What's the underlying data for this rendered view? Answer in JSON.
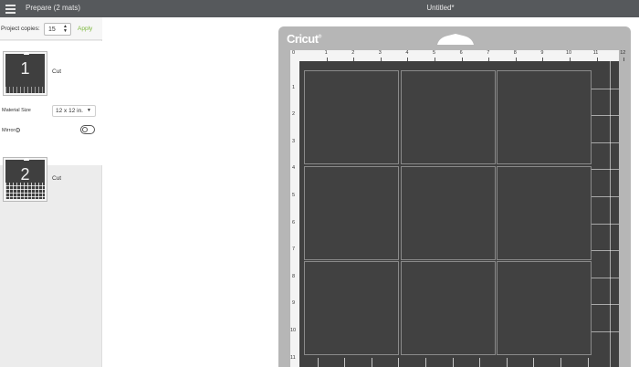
{
  "topbar": {
    "app_title": "Prepare (2 mats)",
    "document_title": "Untitled*"
  },
  "left_panel": {
    "copies_label": "Project copies:",
    "copies_value": "15",
    "apply_label": "Apply",
    "mats": [
      {
        "number": "1",
        "label": "Cut",
        "selected": true
      },
      {
        "number": "2",
        "label": "Cut",
        "selected": false
      }
    ],
    "material_size_label": "Material Size",
    "material_size_value": "12 x 12 in.",
    "mirror_label": "Mirror",
    "mirror_on": false
  },
  "canvas": {
    "brand": "Cricut",
    "ruler_top_labels": [
      "0",
      "1",
      "2",
      "3",
      "4",
      "5",
      "6",
      "7",
      "8",
      "9",
      "10",
      "11",
      "12"
    ],
    "ruler_left_labels": [
      "1",
      "2",
      "3",
      "4",
      "5",
      "6",
      "7",
      "8",
      "9",
      "10",
      "11"
    ],
    "tiles": {
      "rows": 3,
      "cols": 3
    },
    "colors": {
      "mat": "#404040",
      "frame": "#b6b6b6",
      "accent": "#7cb83d",
      "topbar": "#56595c"
    }
  }
}
